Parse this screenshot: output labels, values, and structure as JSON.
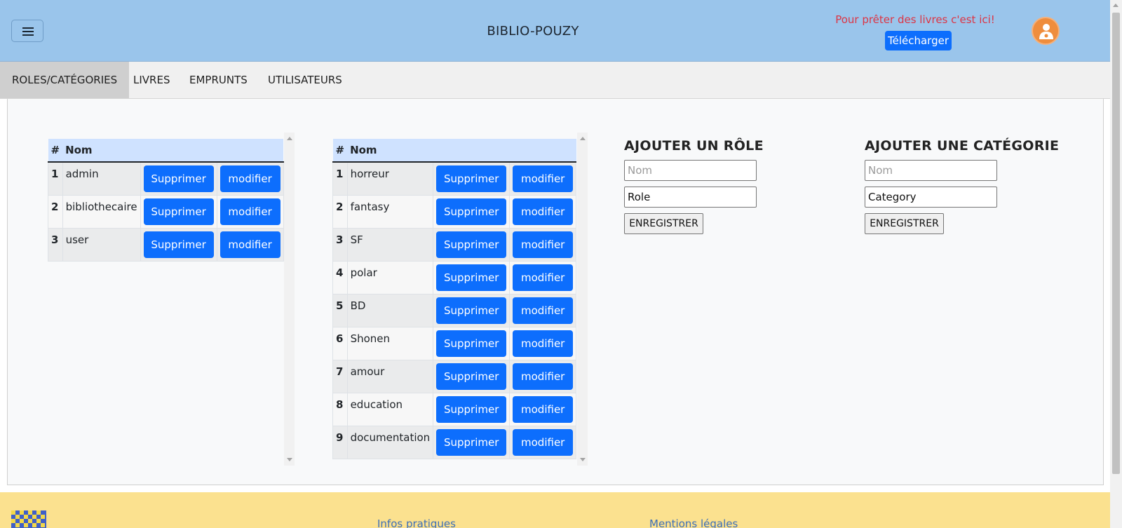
{
  "header": {
    "menu_icon": "hamburger-menu-icon",
    "title": "BIBLIO-POUZY",
    "promo_text": "Pour prêter des livres c'est ici!",
    "download_label": "Télécharger",
    "avatar_icon": "user-avatar-icon",
    "background": "#9ac5eb"
  },
  "nav": {
    "items": [
      {
        "label": "ROLES/CATÉGORIES"
      },
      {
        "label": "LIVRES"
      },
      {
        "label": "EMPRUNTS"
      },
      {
        "label": "UTILISATEURS"
      }
    ]
  },
  "roles_table": {
    "headers": [
      "#",
      "Nom"
    ],
    "rows": [
      {
        "num": "1",
        "name": "admin",
        "delete": "Supprimer",
        "edit": "modifier"
      },
      {
        "num": "2",
        "name": "bibliothecaire",
        "delete": "Supprimer",
        "edit": "modifier"
      },
      {
        "num": "3",
        "name": "user",
        "delete": "Supprimer",
        "edit": "modifier"
      }
    ]
  },
  "categories_table": {
    "headers": [
      "#",
      "Nom"
    ],
    "rows": [
      {
        "num": "1",
        "name": "horreur",
        "delete": "Supprimer",
        "edit": "modifier"
      },
      {
        "num": "2",
        "name": "fantasy",
        "delete": "Supprimer",
        "edit": "modifier"
      },
      {
        "num": "3",
        "name": "SF",
        "delete": "Supprimer",
        "edit": "modifier"
      },
      {
        "num": "4",
        "name": "polar",
        "delete": "Supprimer",
        "edit": "modifier"
      },
      {
        "num": "5",
        "name": "BD",
        "delete": "Supprimer",
        "edit": "modifier"
      },
      {
        "num": "6",
        "name": "Shonen",
        "delete": "Supprimer",
        "edit": "modifier"
      },
      {
        "num": "7",
        "name": "amour",
        "delete": "Supprimer",
        "edit": "modifier"
      },
      {
        "num": "8",
        "name": "education",
        "delete": "Supprimer",
        "edit": "modifier"
      },
      {
        "num": "9",
        "name": "documentation",
        "delete": "Supprimer",
        "edit": "modifier"
      }
    ]
  },
  "add_role": {
    "title": "AJOUTER UN RÔLE",
    "name_placeholder": "Nom",
    "select_value": "Role",
    "submit_label": "ENREGISTRER"
  },
  "add_category": {
    "title": "AJOUTER UNE CATÉGORIE",
    "name_placeholder": "Nom",
    "select_value": "Category",
    "submit_label": "ENREGISTRER"
  },
  "footer": {
    "logo_icon": "checkered-flag-logo-icon",
    "links": [
      {
        "label": "Infos pratiques"
      },
      {
        "label": "Mentions légales"
      }
    ],
    "background": "#fbe18f"
  },
  "colors": {
    "primary_button": "#0d6efd",
    "promo_text": "#dc3545",
    "table_header": "#cfe2ff"
  }
}
